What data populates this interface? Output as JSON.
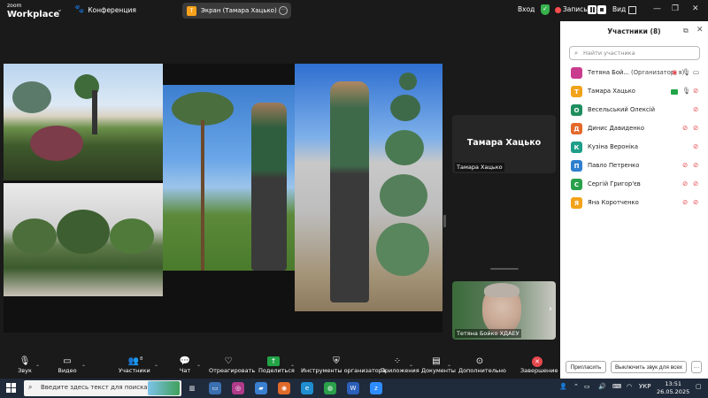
{
  "titlebar": {
    "logo_top": "zoom",
    "logo_bottom": "Workplace",
    "conference_label": "Конференция",
    "share_label": "Экран (Тамара Хацько)",
    "share_badge": "T",
    "signin": "Вход",
    "record_label": "Запись...",
    "view_label": "Вид"
  },
  "stage": {
    "tile_top_name_big": "Тамара Хацько",
    "tile_top_name": "Тамара Хацько",
    "tile_bottom_name": "Тетяна Бойко ХДАЕУ"
  },
  "panel": {
    "title": "Участники (8)",
    "search_placeholder": "Найти участника",
    "participants": [
      {
        "initial": "",
        "name": "Тетяна Бой...",
        "role": "(Организатор, я)",
        "color": "#c93c8e"
      },
      {
        "initial": "Т",
        "name": "Тамара Хацько",
        "role": "",
        "color": "#f2a31a"
      },
      {
        "initial": "О",
        "name": "Весельський Олексій",
        "role": "",
        "color": "#1f8e5f"
      },
      {
        "initial": "Д",
        "name": "Динис Давиденко",
        "role": "",
        "color": "#e4682a"
      },
      {
        "initial": "К",
        "name": "Кузіна Вероніка",
        "role": "",
        "color": "#1f9e8a"
      },
      {
        "initial": "П",
        "name": "Павло Петренко",
        "role": "",
        "color": "#2e7fcf"
      },
      {
        "initial": "С",
        "name": "Сергій Григор'єв",
        "role": "",
        "color": "#2aa04a"
      },
      {
        "initial": "Я",
        "name": "Яна Коротченко",
        "role": "",
        "color": "#f2a31a"
      }
    ],
    "invite_label": "Пригласить",
    "mute_all_label": "Выключить звук для всех"
  },
  "toolbar": {
    "audio": "Звук",
    "video": "Видео",
    "participants": "Участники",
    "participants_count": "8",
    "chat": "Чат",
    "react": "Отреагировать",
    "share": "Поделиться",
    "host_tools": "Инструменты организатора",
    "apps": "Приложения",
    "docs": "Документы",
    "more": "Дополнительно",
    "end": "Завершение"
  },
  "taskbar": {
    "search_text": "Введите здесь текст для поиска",
    "lang": "УКР",
    "time": "13:51",
    "date": "26.05.2025"
  },
  "colors": {
    "accent_green": "#22a447",
    "mute_red": "#e5484d",
    "record_red": "#ff4d4f",
    "taskbar": "#1f2a3a"
  }
}
